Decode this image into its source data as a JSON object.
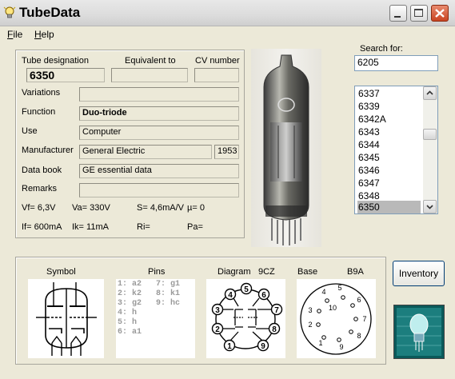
{
  "window": {
    "title": "TubeData"
  },
  "menu": {
    "file": "File",
    "file_key": "F",
    "file_rest": "ile",
    "help": "Help",
    "help_key": "H",
    "help_rest": "elp"
  },
  "form": {
    "tube_designation_label": "Tube designation",
    "equivalent_label": "Equivalent to",
    "cv_number_label": "CV number",
    "tube_designation": "6350",
    "equivalent": "",
    "cv_number": "",
    "variations_label": "Variations",
    "variations": "",
    "function_label": "Function",
    "function": "Duo-triode",
    "use_label": "Use",
    "use": "Computer",
    "manufacturer_label": "Manufacturer",
    "manufacturer": "General Electric",
    "year": "1953",
    "data_book_label": "Data book",
    "data_book": "GE essential data",
    "remarks_label": "Remarks",
    "remarks": "",
    "vf": "Vf= 6,3V",
    "va": "Va= 330V",
    "s": "S= 4,6mA/V",
    "mu": "µ=   0",
    "if": "If= 600mA",
    "ik": "Ik= 11mA",
    "ri": "Ri=",
    "pa": "Pa="
  },
  "search": {
    "label": "Search for:",
    "value": "6205",
    "items": [
      "6337",
      "6339",
      "6342A",
      "6343",
      "6344",
      "6345",
      "6346",
      "6347",
      "6348",
      "6350"
    ],
    "selected": "6350"
  },
  "bottom": {
    "symbol_label": "Symbol",
    "pins_label": "Pins",
    "diagram_label": "Diagram",
    "diagram_code": "9CZ",
    "base_label": "Base",
    "base_code": "B9A",
    "pins_left": [
      "1: a2",
      "2: k2",
      "3: g2",
      "4: h",
      "5: h",
      "6: a1"
    ],
    "pins_right": [
      "7: g1",
      "8: k1",
      "9: hc"
    ],
    "diagram_pins": [
      "1",
      "2",
      "3",
      "4",
      "5",
      "6",
      "7",
      "8",
      "9"
    ],
    "base_pins": [
      "1",
      "2",
      "3",
      "4",
      "5",
      "6",
      "7",
      "8",
      "9",
      "10"
    ]
  },
  "inventory_button": "Inventory",
  "icons": {
    "app": "lightbulb-icon",
    "minimize": "minimize-icon",
    "maximize": "maximize-icon",
    "close": "close-icon",
    "scroll_up": "chevron-up-icon",
    "scroll_down": "chevron-down-icon"
  }
}
